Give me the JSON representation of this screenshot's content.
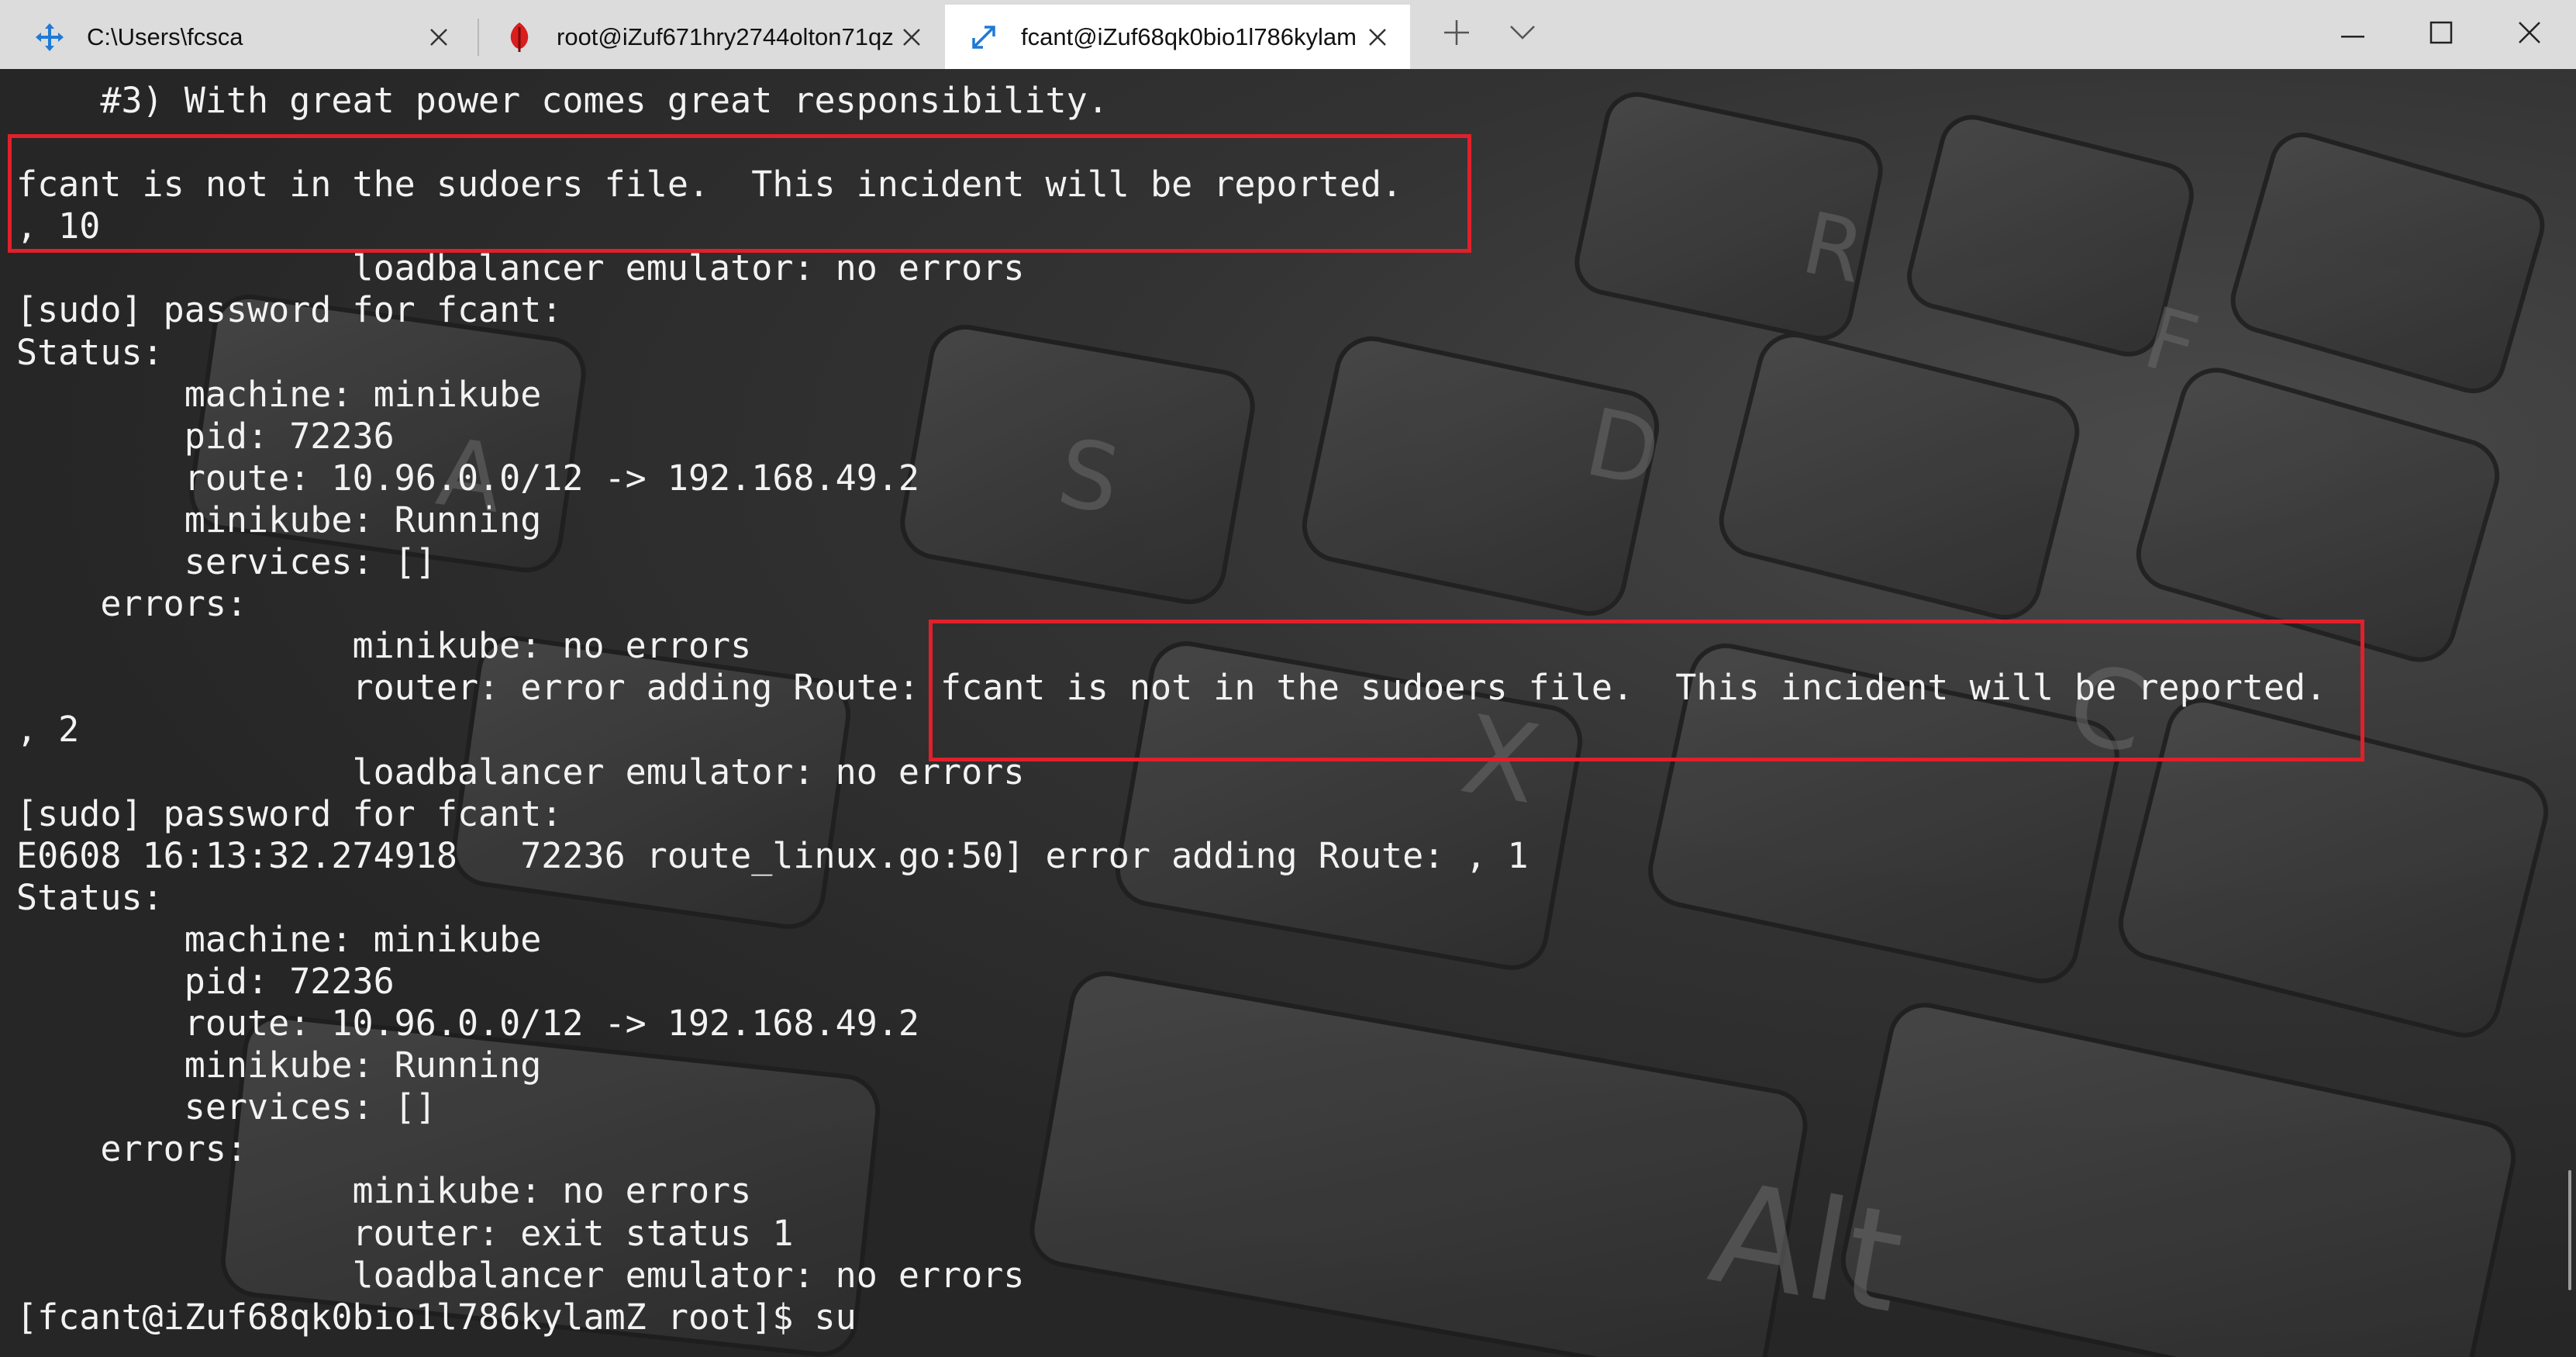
{
  "tabs": [
    {
      "label": "C:\\Users\\fcsca",
      "icon": "move-arrows-icon",
      "active": false
    },
    {
      "label": "root@iZuf671hry2744olton71qz",
      "icon": "red-leaf-icon",
      "active": false
    },
    {
      "label": "fcant@iZuf68qk0bio1l786kylam",
      "icon": "resize-arrows-icon",
      "active": true
    }
  ],
  "toolbar": {
    "new_tab_icon": "plus-icon",
    "dropdown_icon": "chevron-down-icon"
  },
  "window_controls": {
    "minimize_icon": "minimize-icon",
    "maximize_icon": "maximize-icon",
    "close_icon": "close-icon"
  },
  "terminal": {
    "lines": [
      "    #3) With great power comes great responsibility.",
      "",
      "fcant is not in the sudoers file.  This incident will be reported.",
      ", 10",
      "                loadbalancer emulator: no errors",
      "[sudo] password for fcant:",
      "Status:",
      "        machine: minikube",
      "        pid: 72236",
      "        route: 10.96.0.0/12 -> 192.168.49.2",
      "        minikube: Running",
      "        services: []",
      "    errors:",
      "                minikube: no errors",
      "                router: error adding Route: fcant is not in the sudoers file.  This incident will be reported.",
      ", 2",
      "                loadbalancer emulator: no errors",
      "[sudo] password for fcant:",
      "E0608 16:13:32.274918   72236 route_linux.go:50] error adding Route: , 1",
      "Status:",
      "        machine: minikube",
      "        pid: 72236",
      "        route: 10.96.0.0/12 -> 192.168.49.2",
      "        minikube: Running",
      "        services: []",
      "    errors:",
      "                minikube: no errors",
      "                router: exit status 1",
      "                loadbalancer emulator: no errors",
      "[fcant@iZuf68qk0bio1l786kylamZ root]$ su"
    ]
  },
  "colors": {
    "highlight_box": "#e0202a",
    "terminal_text": "#f2f2f2",
    "tab_bar": "#dcdcdc",
    "active_tab": "#ffffff"
  }
}
